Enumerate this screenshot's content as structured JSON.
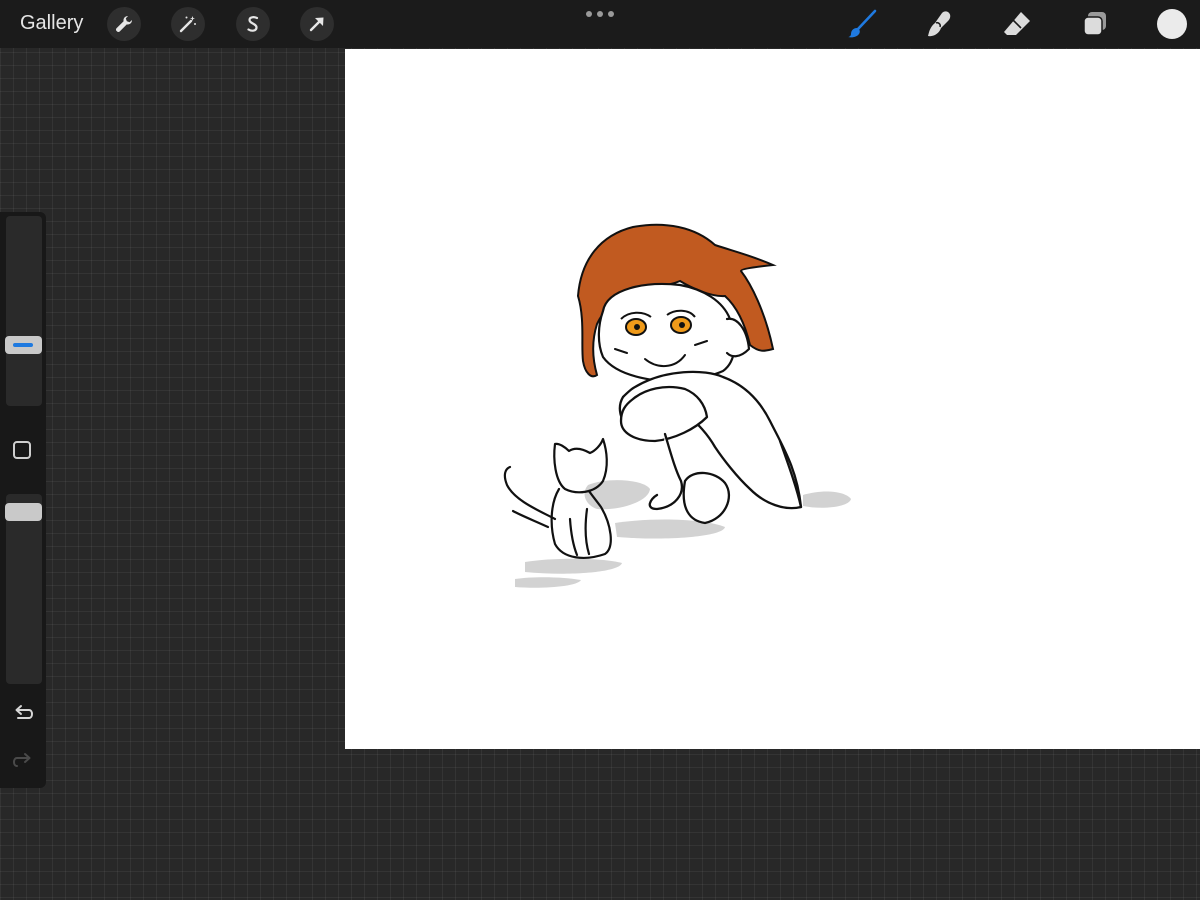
{
  "topbar": {
    "gallery_label": "Gallery",
    "left_tools": [
      {
        "name": "actions",
        "icon": "wrench-icon"
      },
      {
        "name": "adjustments",
        "icon": "magic-wand-icon"
      },
      {
        "name": "selection",
        "icon": "selection-s-icon"
      },
      {
        "name": "transform",
        "icon": "arrow-cursor-icon"
      }
    ],
    "more_menu_icon": "three-dots-icon",
    "right_tools": [
      {
        "name": "brush",
        "icon": "brush-icon",
        "active": true,
        "color": "#1f7ae0"
      },
      {
        "name": "smudge",
        "icon": "smudge-finger-icon"
      },
      {
        "name": "eraser",
        "icon": "eraser-icon"
      },
      {
        "name": "layers",
        "icon": "layers-icon"
      }
    ],
    "current_color": "#ebebeb"
  },
  "sidebar": {
    "brush_size_level": 0.3,
    "opacity_level": 0.95,
    "modify_button_icon": "square-icon",
    "undo_icon": "undo-arrow-icon",
    "redo_icon": "redo-arrow-icon",
    "redo_enabled": false
  },
  "canvas": {
    "background": "#ffffff",
    "artwork": "sketch-drawing",
    "colors": {
      "hair": "#c15a20",
      "eyes": "#ef9a1a",
      "line": "#111111",
      "shadow": "#d2d2d2"
    }
  }
}
